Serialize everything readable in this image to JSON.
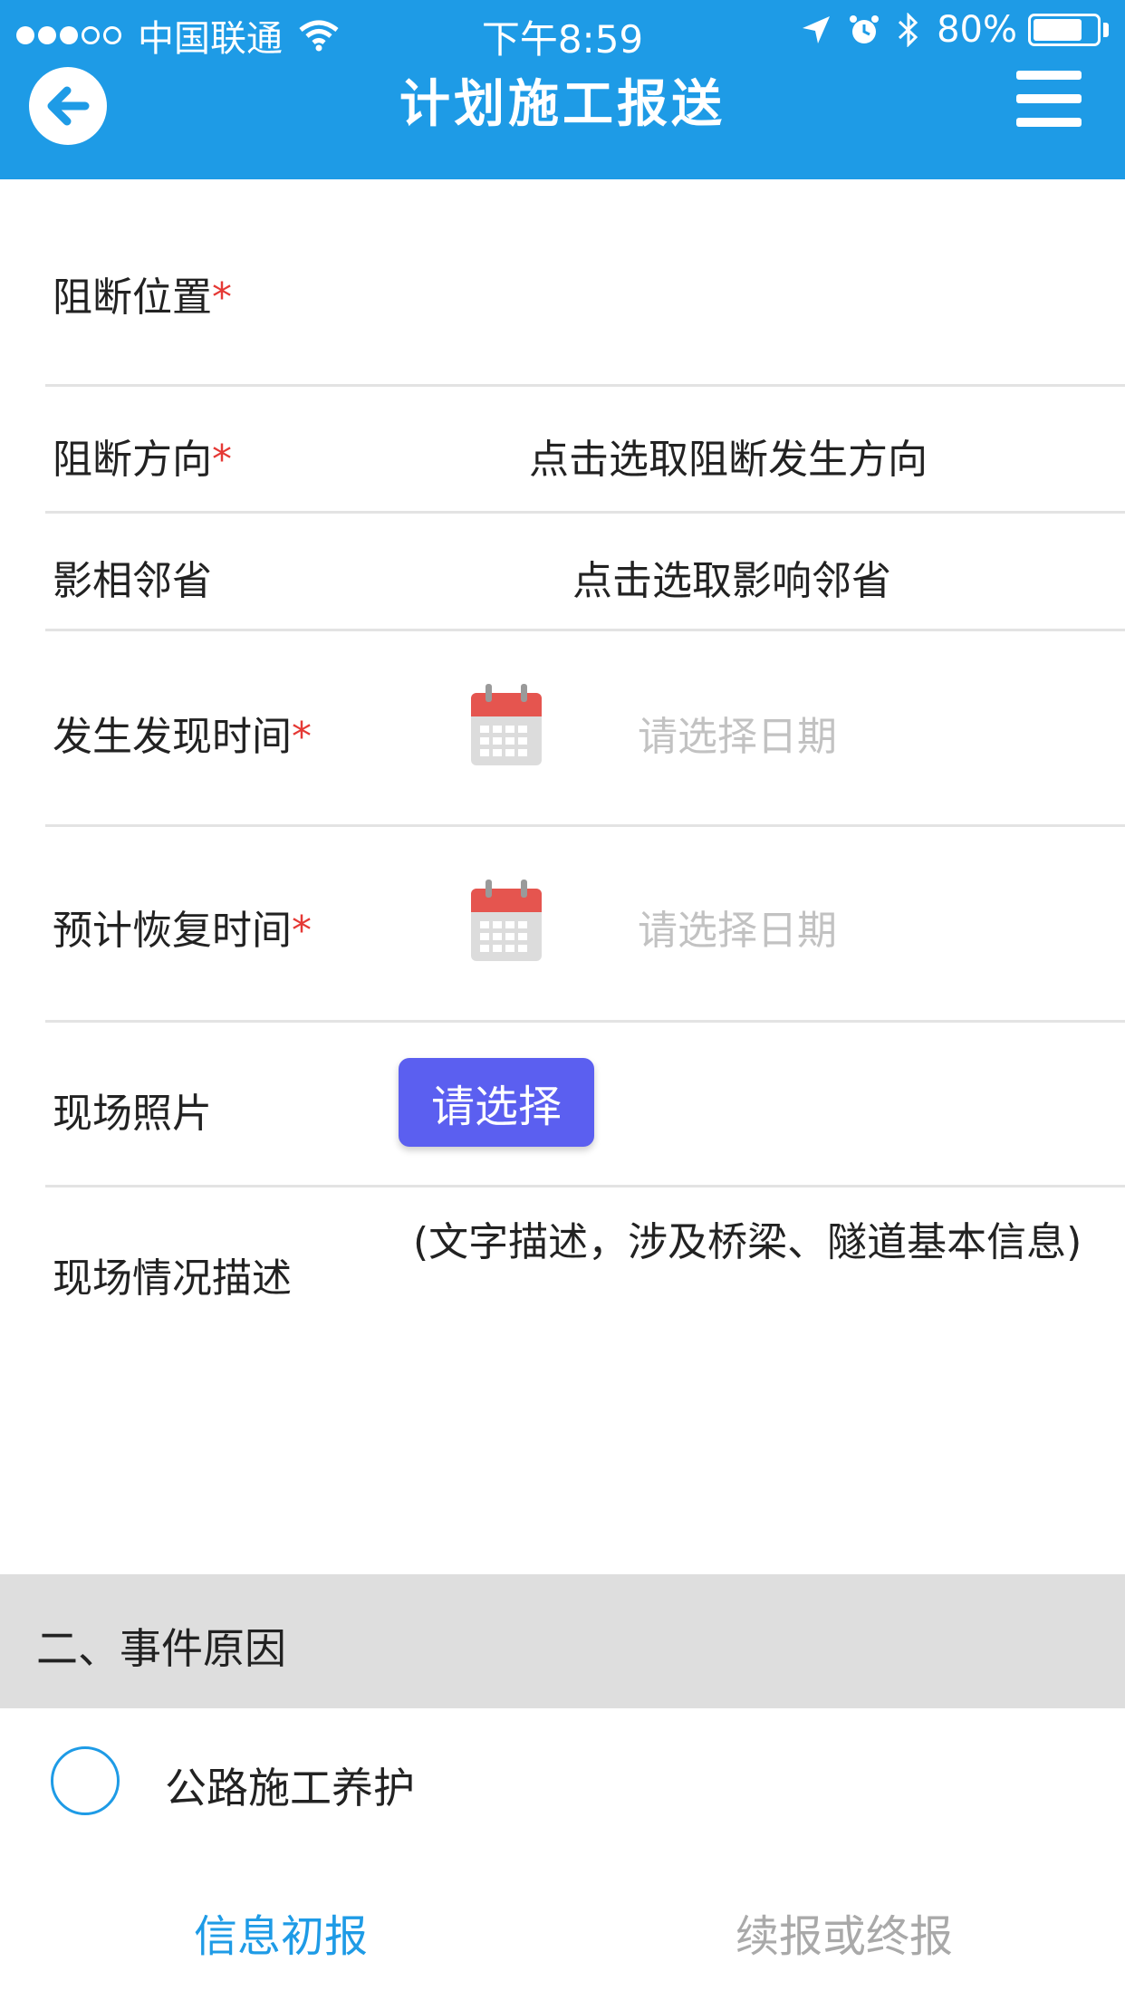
{
  "status_bar": {
    "carrier": "中国联通",
    "time": "下午8:59",
    "battery": "80%",
    "battery_level": 0.8
  },
  "nav": {
    "title": "计划施工报送",
    "back_icon": "arrow-left-circle-icon",
    "menu_icon": "hamburger-menu-icon"
  },
  "form": {
    "block_location": {
      "label": "阻断位置",
      "required": "*"
    },
    "block_direction": {
      "label": "阻断方向",
      "required": "*",
      "value": "点击选取阻断发生方向"
    },
    "neighbor_province": {
      "label": "影相邻省",
      "value": "点击选取影响邻省"
    },
    "occur_time": {
      "label": "发生发现时间",
      "required": "*",
      "placeholder": "请选择日期"
    },
    "recovery_time": {
      "label": "预计恢复时间",
      "required": "*",
      "placeholder": "请选择日期"
    },
    "site_photo": {
      "label": "现场照片",
      "button": "请选择"
    },
    "site_description": {
      "label": "现场情况描述",
      "placeholder": "(文字描述，涉及桥梁、隧道基本信息)"
    }
  },
  "section": {
    "title": "二、事件原因",
    "option": "公路施工养护"
  },
  "bottom_tabs": {
    "initial_report": "信息初报",
    "followup_report": "续报或终报"
  },
  "colors": {
    "accent": "#1e9be6",
    "button": "#5b5ff0",
    "required": "#e53935",
    "hint": "#c2c2c2"
  }
}
